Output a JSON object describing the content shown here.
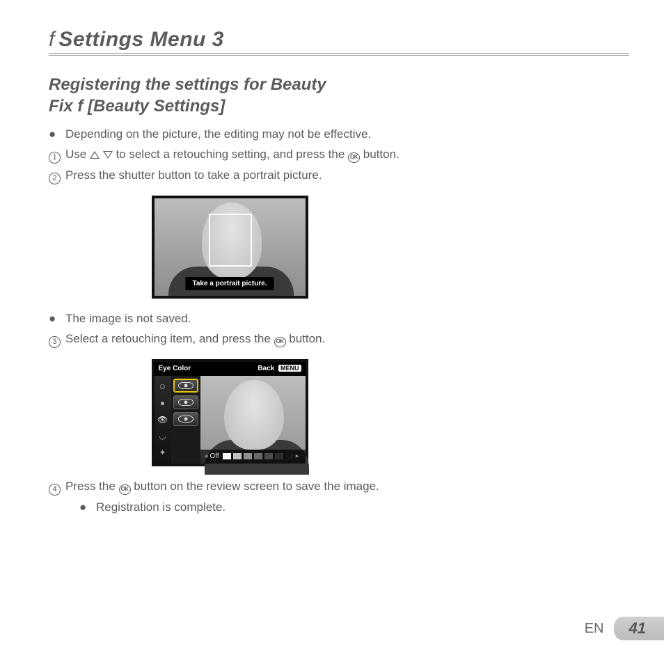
{
  "header": {
    "wrench_glyph": "f",
    "title": "Settings Menu 3"
  },
  "section": {
    "heading_line1": "Registering the settings for Beauty",
    "heading_line2_a": "Fix ",
    "heading_wrench": "f",
    "heading_line2_b": " [Beauty Settings]"
  },
  "notes": {
    "n1": "Depending on the picture, the editing may not be effective.",
    "n2": "The image is not saved.",
    "n3": "Registration is complete."
  },
  "steps": {
    "s1a": "Use ",
    "s1b": " to select a retouching setting, and press the ",
    "s1c": " button.",
    "s2": "Press the shutter button to take a portrait picture.",
    "s3a": "Select a retouching item, and press the ",
    "s3b": " button.",
    "s4a": "Press the ",
    "s4b": " button on the review screen to save the image."
  },
  "glyphs": {
    "ok": "OK",
    "circle1": "1",
    "circle2": "2",
    "circle3": "3",
    "circle4": "4"
  },
  "fig1": {
    "caption": "Take a portrait picture."
  },
  "fig2": {
    "title": "Eye Color",
    "back": "Back",
    "menu": "MENU",
    "off": "Off",
    "swatches": [
      "#ffffff",
      "#bfbfbf",
      "#8f8f8f",
      "#6a6a6a",
      "#4a4a4a",
      "#2e2e2e",
      "#161616"
    ]
  },
  "footer": {
    "lang": "EN",
    "page": "41"
  }
}
